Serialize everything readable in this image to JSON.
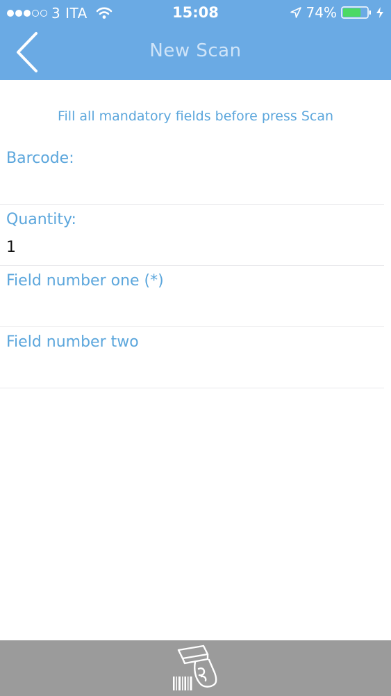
{
  "status_bar": {
    "carrier": "3 ITA",
    "time": "15:08",
    "battery_percent": "74%",
    "battery_level": 0.74,
    "signal_bars_filled": 3,
    "signal_bars_total": 5
  },
  "nav": {
    "title": "New Scan"
  },
  "hint": "Fill all mandatory fields before press Scan",
  "fields": [
    {
      "label": "Barcode:",
      "value": ""
    },
    {
      "label": "Quantity:",
      "value": "1"
    },
    {
      "label": "Field number one (*)",
      "value": ""
    },
    {
      "label": "Field number two",
      "value": ""
    }
  ],
  "icons": {
    "back": "chevron-left-icon",
    "scan": "barcode-scanner-icon"
  },
  "colors": {
    "header": "#6aaae4",
    "accent_text": "#5ba6dc",
    "bottom_bar": "#9b9b9b",
    "battery_fill": "#4cd964"
  }
}
